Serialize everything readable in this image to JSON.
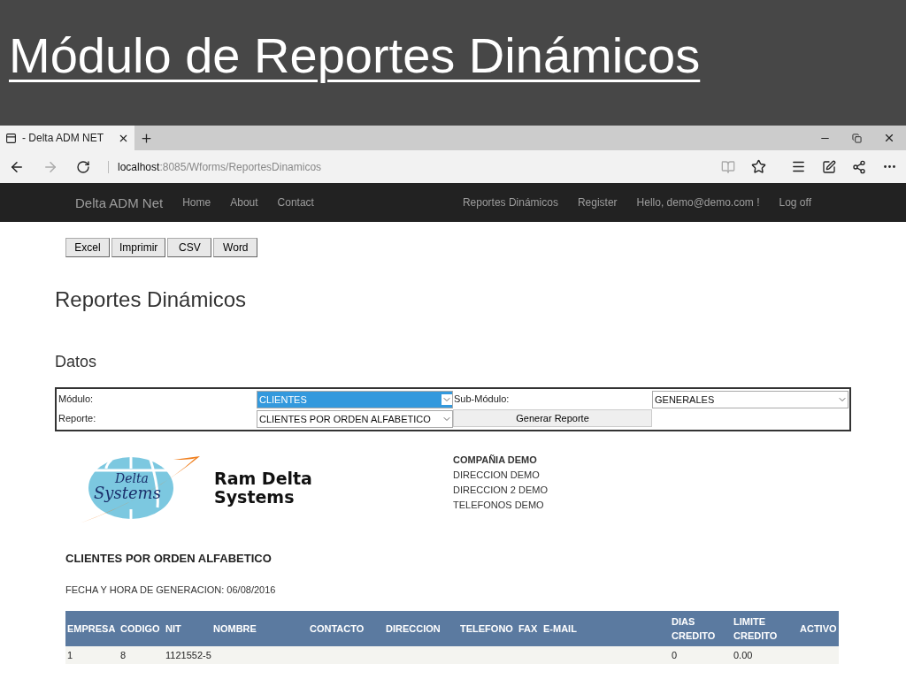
{
  "slide": {
    "title": "Módulo de Reportes Dinámicos"
  },
  "browser": {
    "tab": {
      "title": "- Delta ADM NET"
    },
    "address": {
      "host": "localhost",
      "path": ":8085/Wforms/ReportesDinamicos"
    },
    "favorite": false
  },
  "navbar": {
    "brand": "Delta ADM Net",
    "left_links": [
      "Home",
      "About",
      "Contact"
    ],
    "right_links": [
      "Reportes Dinámicos",
      "Register",
      "Hello, demo@demo.com !",
      "Log off"
    ]
  },
  "export_buttons": [
    "Excel",
    "Imprimir",
    "CSV",
    "Word"
  ],
  "page_title": "Reportes Dinámicos",
  "section_title": "Datos",
  "form": {
    "modulo_label": "Módulo:",
    "modulo_value": "CLIENTES",
    "modulo_focused": true,
    "submodulo_label": "Sub-Módulo:",
    "submodulo_value": "GENERALES",
    "reporte_label": "Reporte:",
    "reporte_value": "CLIENTES POR ORDEN ALFABETICO",
    "generate_button": "Generar Reporte"
  },
  "report_header": {
    "logo_script": [
      "Delta",
      "Systems"
    ],
    "logo_text": [
      "Ram Delta",
      "Systems"
    ],
    "company": "COMPAÑIA DEMO",
    "address_lines": [
      "DIRECCION DEMO",
      "DIRECCION 2 DEMO",
      "TELEFONOS DEMO"
    ]
  },
  "report_title": "CLIENTES POR ORDEN ALFABETICO",
  "generated": "FECHA Y HORA DE GENERACION: 06/08/2016",
  "table": {
    "columns": [
      "EMPRESA",
      "CODIGO",
      "NIT",
      "NOMBRE",
      "CONTACTO",
      "DIRECCION",
      "TELEFONO",
      "FAX",
      "E-MAIL",
      "DIAS CREDITO",
      "LIMITE CREDITO",
      "ACTIVO"
    ],
    "rows": [
      {
        "cells": [
          "1",
          "8",
          "1121552-5",
          null,
          null,
          null,
          null,
          null,
          null,
          "0",
          "0.00",
          null
        ]
      }
    ]
  }
}
